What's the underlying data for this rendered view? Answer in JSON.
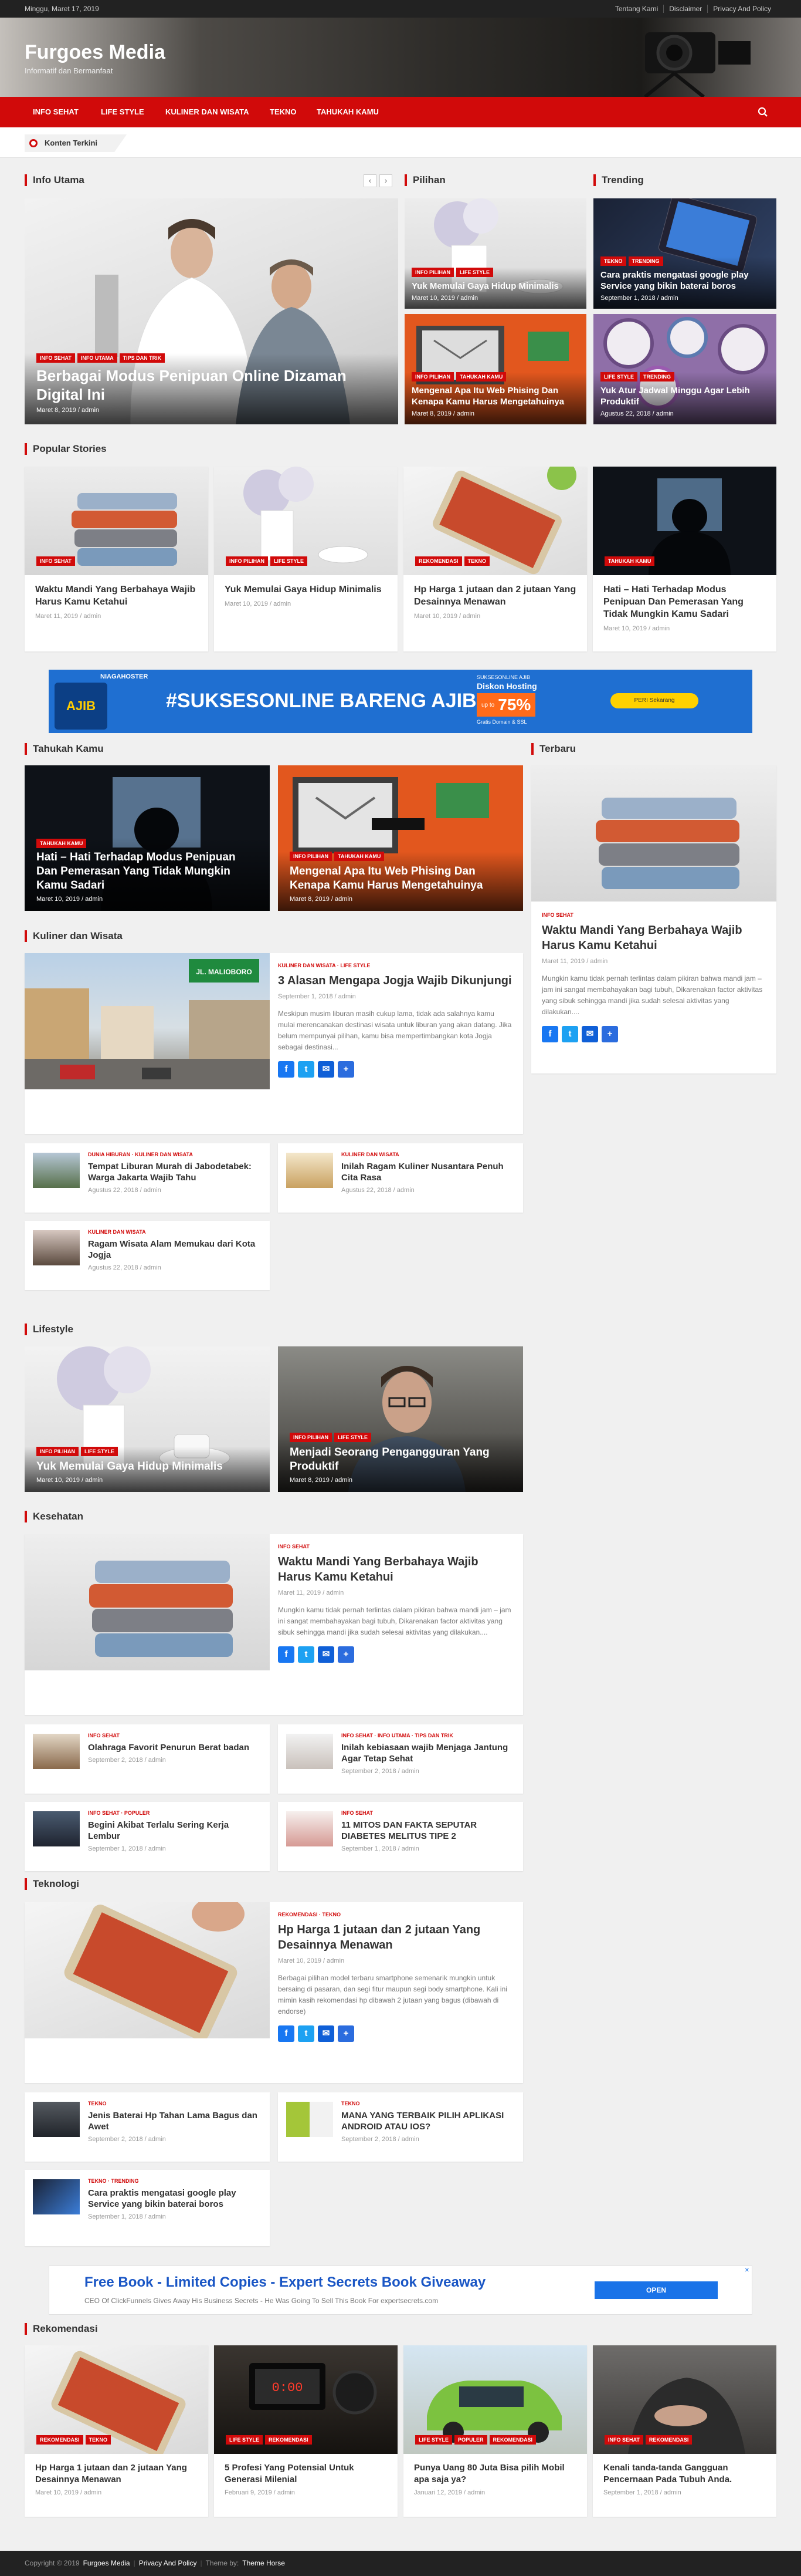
{
  "topbar": {
    "date": "Minggu, Maret 17, 2019",
    "links": [
      "Tentang Kami",
      "Disclaimer",
      "Privacy And Policy"
    ]
  },
  "site": {
    "title": "Furgoes Media",
    "tagline": "Informatif dan Bermanfaat"
  },
  "nav": [
    "INFO SEHAT",
    "LIFE STYLE",
    "KULINER DAN WISATA",
    "TEKNO",
    "TAHUKAH KAMU"
  ],
  "ticker_label": "Konten Terkini",
  "sections": {
    "info_utama": "Info Utama",
    "pilihan": "Pilihan",
    "trending": "Trending",
    "popular": "Popular Stories",
    "tahukah": "Tahukah Kamu",
    "terbaru": "Terbaru",
    "kuliner": "Kuliner dan Wisata",
    "lifestyle": "Lifestyle",
    "kesehatan": "Kesehatan",
    "teknologi": "Teknologi",
    "rekomendasi": "Rekomendasi"
  },
  "hero": {
    "tags": [
      "INFO SEHAT",
      "INFO UTAMA",
      "TIPS DAN TRIK"
    ],
    "title": "Berbagai Modus Penipuan Online Dizaman Digital Ini",
    "meta": "Maret 8, 2019 / admin"
  },
  "pilihan": [
    {
      "tags": [
        "INFO PILIHAN",
        "LIFE STYLE"
      ],
      "title": "Yuk Memulai Gaya Hidup Minimalis",
      "meta": "Maret 10, 2019 / admin"
    },
    {
      "tags": [
        "INFO PILIHAN",
        "TAHUKAH KAMU"
      ],
      "title": "Mengenal Apa Itu Web Phising Dan Kenapa Kamu Harus Mengetahuinya",
      "meta": "Maret 8, 2019 / admin"
    }
  ],
  "trending": [
    {
      "tags": [
        "TEKNO",
        "TRENDING"
      ],
      "title": "Cara praktis mengatasi google play Service yang bikin baterai boros",
      "meta": "September 1, 2018 / admin"
    },
    {
      "tags": [
        "LIFE STYLE",
        "TRENDING"
      ],
      "title": "Yuk Atur Jadwal Minggu Agar Lebih Produktif",
      "meta": "Agustus 22, 2018 / admin"
    }
  ],
  "popular": [
    {
      "tag": "INFO SEHAT",
      "title": "Waktu Mandi Yang Berbahaya Wajib Harus Kamu Ketahui",
      "meta": "Maret 11, 2019 / admin"
    },
    {
      "tags": [
        "INFO PILIHAN",
        "LIFE STYLE"
      ],
      "title": "Yuk Memulai Gaya Hidup Minimalis",
      "meta": "Maret 10, 2019 / admin"
    },
    {
      "tags": [
        "REKOMENDASI",
        "TEKNO"
      ],
      "title": "Hp Harga 1 jutaan dan 2 jutaan Yang Desainnya Menawan",
      "meta": "Maret 10, 2019 / admin"
    },
    {
      "tag": "TAHUKAH KAMU",
      "title": "Hati – Hati Terhadap Modus Penipuan Dan Pemerasan Yang Tidak Mungkin Kamu Sadari",
      "meta": "Maret 10, 2019 / admin"
    }
  ],
  "ad1": {
    "brand": "NIAGAHOSTER",
    "headline": "#SUKSESONLINE BARENG AJIB",
    "badge": "AJIB",
    "promo_sub": "SUKSESONLINE AJIB",
    "promo": "Diskon Hosting",
    "upto": "up to",
    "pct": "75%",
    "promo_note": "Gratis Domain & SSL",
    "cta": "PERI Sekarang"
  },
  "tahukah": [
    {
      "tag": "TAHUKAH KAMU",
      "title": "Hati – Hati Terhadap Modus Penipuan Dan Pemerasan Yang Tidak Mungkin Kamu Sadari",
      "meta": "Maret 10, 2019 / admin"
    },
    {
      "tags": [
        "INFO PILIHAN",
        "TAHUKAH KAMU"
      ],
      "title": "Mengenal Apa Itu Web Phising Dan Kenapa Kamu Harus Mengetahuinya",
      "meta": "Maret 8, 2019 / admin"
    }
  ],
  "terbaru": {
    "cat": "INFO SEHAT",
    "title": "Waktu Mandi Yang Berbahaya Wajib Harus Kamu Ketahui",
    "meta": "Maret 11, 2019 / admin",
    "excerpt": "Mungkin kamu tidak pernah terlintas dalam pikiran bahwa mandi jam – jam ini sangat membahayakan bagi tubuh, Dikarenakan factor aktivitas yang sibuk sehingga mandi jika sudah selesai aktivitas yang dilakukan...."
  },
  "kuliner": {
    "main": {
      "cats": "KULINER DAN WISATA · LIFE STYLE",
      "title": "3 Alasan Mengapa Jogja Wajib Dikunjungi",
      "meta": "September 1, 2018 / admin",
      "excerpt": "Meskipun musim liburan masih cukup lama, tidak ada salahnya kamu mulai merencanakan destinasi wisata untuk liburan yang akan datang. Jika belum mempunyai pilihan, kamu bisa mempertimbangkan kota Jogja sebagai destinasi...",
      "sign": "JL. MALIOBORO"
    },
    "list": [
      {
        "cats": "DUNIA HIBURAN · KULINER DAN WISATA",
        "title": "Tempat Liburan Murah di Jabodetabek: Warga Jakarta Wajib Tahu",
        "meta": "Agustus 22, 2018 / admin"
      },
      {
        "cats": "KULINER DAN WISATA",
        "title": "Inilah Ragam Kuliner Nusantara Penuh Cita Rasa",
        "meta": "Agustus 22, 2018 / admin"
      },
      {
        "cats": "KULINER DAN WISATA",
        "title": "Ragam Wisata Alam Memukau dari Kota Jogja",
        "meta": "Agustus 22, 2018 / admin"
      }
    ]
  },
  "lifestyle": [
    {
      "tags": [
        "INFO PILIHAN",
        "LIFE STYLE"
      ],
      "title": "Yuk Memulai Gaya Hidup Minimalis",
      "meta": "Maret 10, 2019 / admin"
    },
    {
      "tags": [
        "INFO PILIHAN",
        "LIFE STYLE"
      ],
      "title": "Menjadi Seorang Pengangguran Yang Produktif",
      "meta": "Maret 8, 2019 / admin"
    }
  ],
  "kesehatan": {
    "main": {
      "cats": "INFO SEHAT",
      "title": "Waktu Mandi Yang Berbahaya Wajib Harus Kamu Ketahui",
      "meta": "Maret 11, 2019 / admin",
      "excerpt": "Mungkin kamu tidak pernah terlintas dalam pikiran bahwa mandi jam – jam ini sangat membahayakan bagi tubuh, Dikarenakan factor aktivitas yang sibuk sehingga mandi jika sudah selesai aktivitas yang dilakukan...."
    },
    "list": [
      {
        "cats": "INFO SEHAT",
        "title": "Olahraga Favorit Penurun Berat badan",
        "meta": "September 2, 2018 / admin"
      },
      {
        "cats": "INFO SEHAT · INFO UTAMA · TIPS DAN TRIK",
        "title": "Inilah kebiasaan wajib Menjaga Jantung Agar Tetap Sehat",
        "meta": "September 2, 2018 / admin"
      },
      {
        "cats": "INFO SEHAT · POPULER",
        "title": "Begini Akibat Terlalu Sering Kerja Lembur",
        "meta": "September 1, 2018 / admin"
      },
      {
        "cats": "INFO SEHAT",
        "title": "11 MITOS DAN FAKTA SEPUTAR DIABETES MELITUS TIPE 2",
        "meta": "September 1, 2018 / admin"
      }
    ]
  },
  "teknologi": {
    "main": {
      "cats": "REKOMENDASI · TEKNO",
      "title": "Hp Harga 1 jutaan dan 2 jutaan Yang Desainnya Menawan",
      "meta": "Maret 10, 2019 / admin",
      "excerpt": "Berbagai pilihan model terbaru smartphone semenarik mungkin untuk bersaing di pasaran, dan segi fitur maupun segi body smartphone. Kali ini mimin kasih rekomendasi hp dibawah 2 jutaan yang bagus (dibawah di endorse)"
    },
    "list": [
      {
        "cats": "TEKNO",
        "title": "Jenis Baterai Hp Tahan Lama Bagus dan Awet",
        "meta": "September 2, 2018 / admin"
      },
      {
        "cats": "TEKNO",
        "title": "MANA YANG TERBAIK PILIH APLIKASI ANDROID ATAU IOS?",
        "meta": "September 2, 2018 / admin"
      },
      {
        "cats": "TEKNO · TRENDING",
        "title": "Cara praktis mengatasi google play Service yang bikin baterai boros",
        "meta": "September 1, 2018 / admin"
      }
    ]
  },
  "ad2": {
    "title": "Free Book - Limited Copies - Expert Secrets Book Giveaway",
    "sub": "CEO Of ClickFunnels Gives Away His Business Secrets - He Was Going To Sell This Book For expertsecrets.com",
    "cta": "OPEN"
  },
  "rekomendasi": [
    {
      "tags": [
        "REKOMENDASI",
        "TEKNO"
      ],
      "title": "Hp Harga 1 jutaan dan 2 jutaan Yang Desainnya Menawan",
      "meta": "Maret 10, 2019 / admin"
    },
    {
      "tags": [
        "LIFE STYLE",
        "REKOMENDASI"
      ],
      "title": "5 Profesi Yang Potensial Untuk Generasi Milenial",
      "meta": "Februari 9, 2019 / admin"
    },
    {
      "tags": [
        "LIFE STYLE",
        "POPULER",
        "REKOMENDASI"
      ],
      "title": "Punya Uang 80 Juta Bisa pilih Mobil apa saja ya?",
      "meta": "Januari 12, 2019 / admin"
    },
    {
      "tags": [
        "INFO SEHAT",
        "REKOMENDASI"
      ],
      "title": "Kenali tanda-tanda Gangguan Pencernaan Pada Tubuh Anda.",
      "meta": "September 1, 2018 / admin"
    }
  ],
  "footer": {
    "copyright": "Copyright © 2019",
    "brand": "Furgoes Media",
    "privacy": "Privacy And Policy",
    "theme_by": "Theme by:",
    "theme": "Theme Horse"
  },
  "colors": {
    "accent": "#d10a0a",
    "topbar": "#222222",
    "footer": "#222222"
  }
}
